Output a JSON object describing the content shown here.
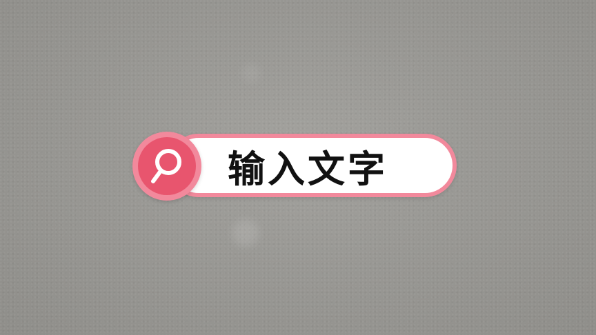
{
  "search": {
    "text": "输入文字",
    "icon": "search-icon"
  },
  "colors": {
    "background": "#999894",
    "accent": "#f2899c",
    "accent_dark": "#e8556e",
    "pill": "#ffffff",
    "text": "#111111"
  }
}
